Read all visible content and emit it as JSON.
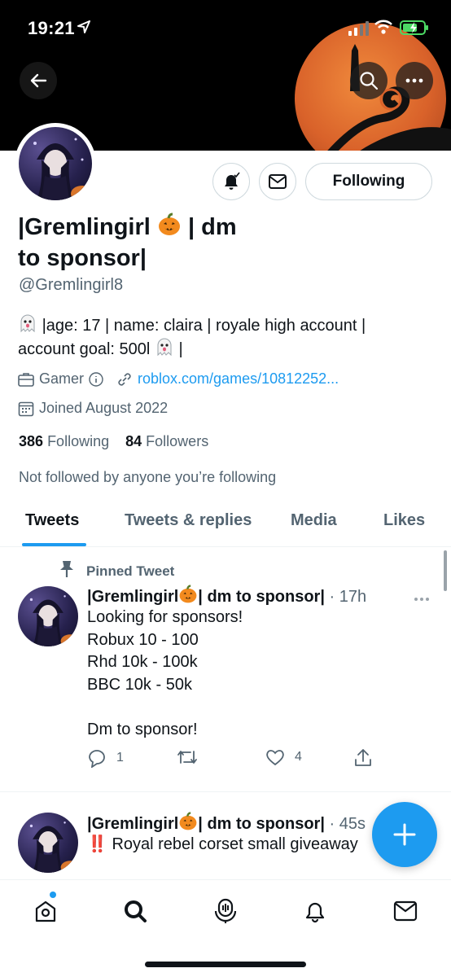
{
  "status_bar": {
    "time": "19:21"
  },
  "profile": {
    "display_name": "|Gremlingirl 🎃| dm to sponsor|",
    "display_name_line1": "|Gremlingirl",
    "display_name_line1b": "| dm",
    "display_name_line2": "to sponsor|",
    "handle": "@Gremlingirl8",
    "bio_line1": "|age: 17 | name: claira | royale high account |",
    "bio_line2_a": "account goal: 500l",
    "bio_line2_b": "|",
    "category": "Gamer",
    "link": "roblox.com/games/10812252...",
    "joined": "Joined August 2022",
    "following_count": "386",
    "following_label": "Following",
    "followers_count": "84",
    "followers_label": "Followers",
    "not_followed": "Not followed by anyone you’re following"
  },
  "actions": {
    "following_button": "Following"
  },
  "tabs": [
    {
      "label": "Tweets",
      "active": true
    },
    {
      "label": "Tweets & replies",
      "active": false
    },
    {
      "label": "Media",
      "active": false
    },
    {
      "label": "Likes",
      "active": false
    }
  ],
  "tweets": [
    {
      "pinned_label": "Pinned Tweet",
      "name_a": "|Gremlingirl",
      "name_b": "| dm to sponsor|",
      "time": "· 17h",
      "lines": [
        "Looking for sponsors!",
        "Robux 10 - 100",
        "Rhd 10k - 100k",
        "BBC 10k - 50k",
        "",
        "Dm to sponsor!"
      ],
      "replies": "1",
      "retweets": "",
      "likes": "4"
    },
    {
      "name_a": "|Gremlingirl",
      "name_b": "| dm to sponsor|",
      "time": "· 45s",
      "text": "‼️ Royal rebel corset small giveaway"
    }
  ],
  "colors": {
    "accent": "#1d9bf0",
    "text": "#0f1419",
    "secondary": "#536471",
    "border": "#cfd9de"
  },
  "icons": [
    "back-arrow-icon",
    "search-icon",
    "more-icon",
    "bell-icon",
    "mail-icon",
    "briefcase-icon",
    "info-icon",
    "link-icon",
    "calendar-icon",
    "pin-icon",
    "reply-icon",
    "retweet-icon",
    "like-icon",
    "share-icon",
    "compose-icon",
    "home-icon",
    "explore-icon",
    "spaces-icon",
    "notifications-icon",
    "messages-icon"
  ]
}
